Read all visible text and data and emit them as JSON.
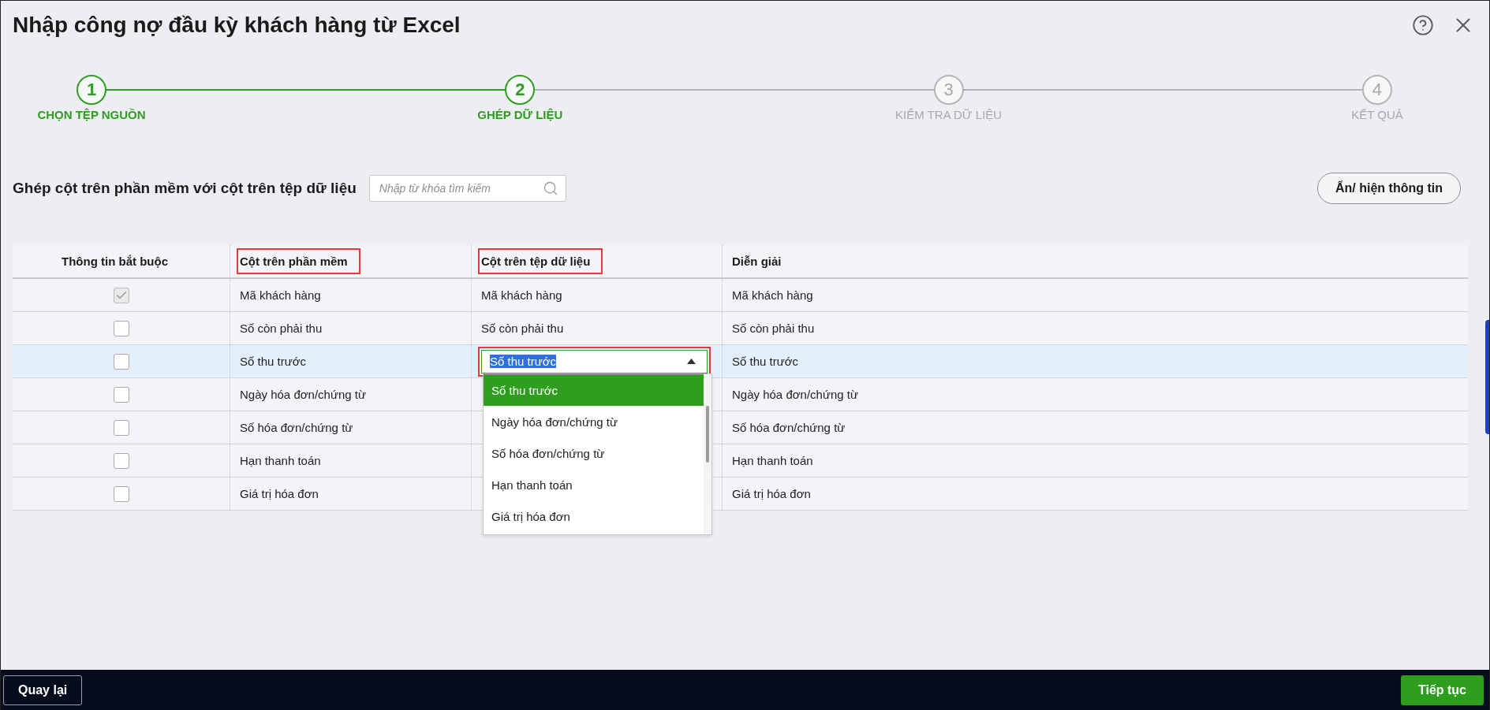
{
  "window": {
    "title": "Nhập công nợ đầu kỳ khách hàng từ Excel"
  },
  "steps": [
    {
      "number": "1",
      "label": "CHỌN TỆP NGUỒN",
      "active": true
    },
    {
      "number": "2",
      "label": "GHÉP DỮ LIỆU",
      "active": true
    },
    {
      "number": "3",
      "label": "KIỂM TRA DỮ LIỆU",
      "active": false
    },
    {
      "number": "4",
      "label": "KẾT QUẢ",
      "active": false
    }
  ],
  "mapping": {
    "heading": "Ghép cột trên phần mềm với cột trên tệp dữ liệu",
    "search": {
      "placeholder": "Nhập từ khóa tìm kiếm"
    },
    "toggle_button": "Ẩn/ hiện thông tin"
  },
  "table": {
    "columns": [
      {
        "label": "Thông tin bắt buộc",
        "highlighted": false
      },
      {
        "label": "Cột trên phần mềm",
        "highlighted": true
      },
      {
        "label": "Cột trên tệp dữ liệu",
        "highlighted": true
      },
      {
        "label": "Diễn giải",
        "highlighted": false
      }
    ],
    "rows": [
      {
        "required": true,
        "disabled": true,
        "selected": false,
        "software_column": "Mã khách hàng",
        "file_column": "Mã khách hàng",
        "description": "Mã khách hàng"
      },
      {
        "required": false,
        "disabled": false,
        "selected": false,
        "software_column": "Số còn phải thu",
        "file_column": "Số còn phải thu",
        "description": "Số còn phải thu"
      },
      {
        "required": false,
        "disabled": false,
        "selected": true,
        "software_column": "Số thu trước",
        "file_select": {
          "value": "Số thu trước",
          "highlighted": true,
          "open": true,
          "options": [
            {
              "label": "Số thu trước",
              "selected": true
            },
            {
              "label": "Ngày hóa đơn/chứng từ",
              "selected": false
            },
            {
              "label": "Số hóa đơn/chứng từ",
              "selected": false
            },
            {
              "label": "Hạn thanh toán",
              "selected": false
            },
            {
              "label": "Giá trị hóa đơn",
              "selected": false
            }
          ]
        },
        "description": "Số thu trước"
      },
      {
        "required": false,
        "disabled": false,
        "selected": false,
        "software_column": "Ngày hóa đơn/chứng từ",
        "description": "Ngày hóa đơn/chứng từ"
      },
      {
        "required": false,
        "disabled": false,
        "selected": false,
        "software_column": "Số hóa đơn/chứng từ",
        "description": "Số hóa đơn/chứng từ"
      },
      {
        "required": false,
        "disabled": false,
        "selected": false,
        "software_column": "Hạn thanh toán",
        "description": "Hạn thanh toán"
      },
      {
        "required": false,
        "disabled": false,
        "selected": false,
        "software_column": "Giá trị hóa đơn",
        "description": "Giá trị hóa đơn"
      }
    ]
  },
  "footer": {
    "back": "Quay lại",
    "next": "Tiếp tục"
  }
}
